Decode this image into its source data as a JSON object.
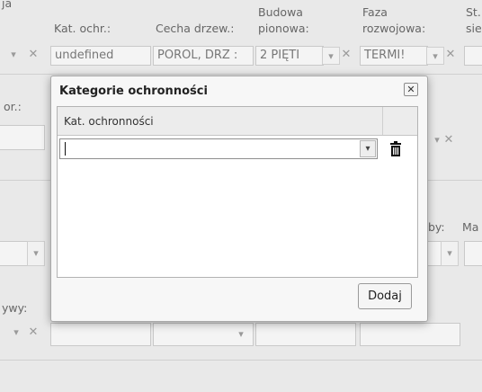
{
  "top_labels": {
    "cut_left": "ja",
    "kat_ochr": "Kat. ochr.:",
    "cecha_drzew": "Cecha drzew.:",
    "budowa_1": "Budowa",
    "budowa_2": "pionowa:",
    "faza_1": "Faza",
    "faza_2": "rozwojowa:",
    "cut_right_1": "St.",
    "cut_right_2": "sie"
  },
  "top_fields": {
    "kat_ochr_value": "undefined",
    "cecha_drzew_value": "POROL, DRZ :",
    "budowa_value": "2 PIĘTI",
    "faza_value": "TERMI!"
  },
  "left_labels": {
    "cut_pr": "or.:",
    "cut_by": "by:",
    "cut_ma": "Ma",
    "cut_ywy": "ywy:"
  },
  "dialog": {
    "title": "Kategorie ochronności",
    "close_glyph": "✕",
    "column_header": "Kat. ochronności",
    "select_value": "",
    "dropdown_glyph": "▾",
    "add_button": "Dodaj"
  },
  "glyphs": {
    "chevron": "▾",
    "clear": "✕"
  }
}
